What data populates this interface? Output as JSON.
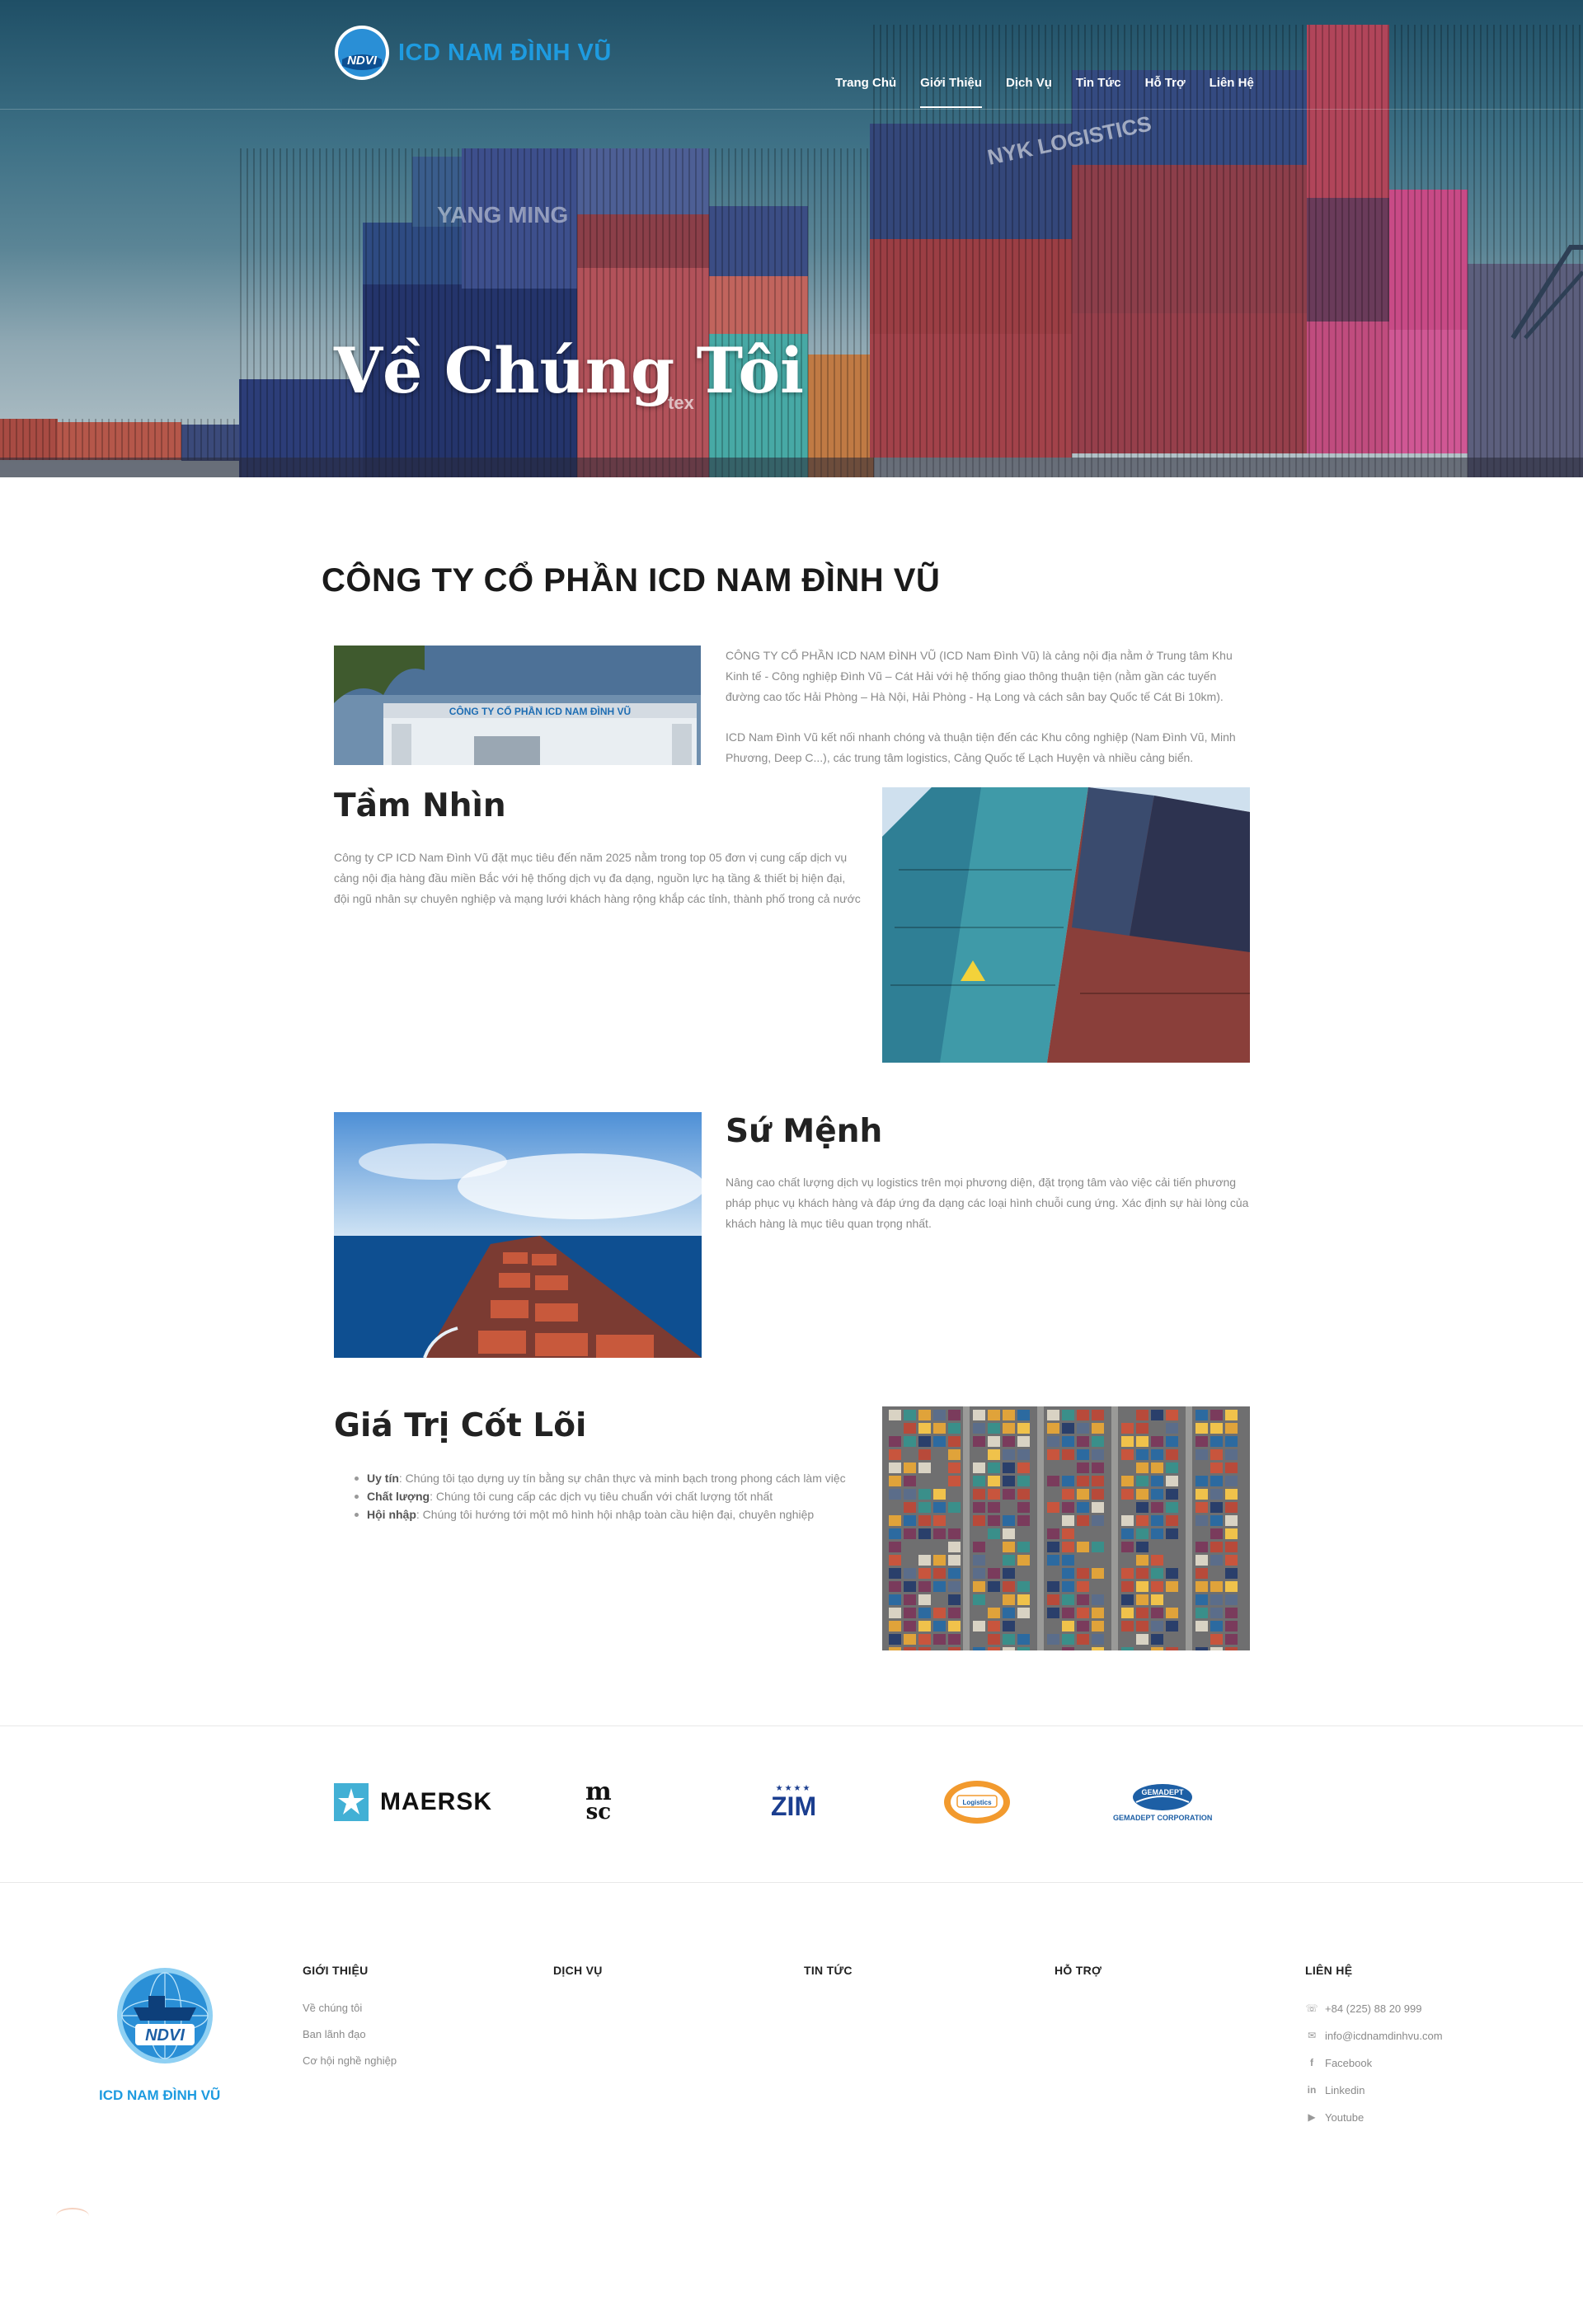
{
  "header": {
    "brand": "ICD NAM ĐÌNH VŨ",
    "logo_text": "NDVI",
    "nav": [
      {
        "label": "Trang Chủ",
        "active": false
      },
      {
        "label": "Giới Thiệu",
        "active": true
      },
      {
        "label": "Dịch Vụ",
        "active": false
      },
      {
        "label": "Tin Tức",
        "active": false
      },
      {
        "label": "Hỗ Trợ",
        "active": false
      },
      {
        "label": "Liên Hệ",
        "active": false
      }
    ]
  },
  "hero": {
    "title": "Về Chúng Tôi",
    "container_labels": [
      "NYK LOGISTICS",
      "YANG MING",
      "tex"
    ]
  },
  "intro": {
    "title": "CÔNG TY CỔ PHẦN ICD NAM ĐÌNH VŨ",
    "image_sign": "CÔNG TY CỔ PHẦN ICD NAM ĐÌNH VŨ",
    "paragraph1": "CÔNG TY CỔ PHẦN ICD NAM ĐÌNH VŨ (ICD Nam Đình Vũ) là cảng nội địa nằm ở Trung tâm Khu Kinh tế - Công nghiệp Đình Vũ – Cát Hải với hệ thống giao thông thuận tiện (nằm gần các tuyến đường cao tốc Hải Phòng – Hà Nội, Hải Phòng - Hạ Long và cách sân bay Quốc tế Cát Bi 10km).",
    "paragraph2": "ICD Nam Đình Vũ kết nối nhanh chóng và thuận tiện đến các Khu công nghiệp (Nam Đình Vũ, Minh Phương, Deep C...), các trung tâm logistics, Cảng Quốc tế Lạch Huyện và nhiều cảng biển."
  },
  "vision": {
    "title": "Tầm Nhìn",
    "text": "Công ty CP ICD Nam Đình Vũ đặt mục tiêu đến năm 2025 nằm trong top 05 đơn vị cung cấp dịch vụ cảng nội địa hàng đầu miền Bắc với hệ thống dịch vụ đa dạng, nguồn lực hạ tầng & thiết bị hiện đại, đội ngũ nhân sự chuyên nghiệp và mạng lưới khách hàng rộng khắp các tỉnh, thành phố trong cả nước"
  },
  "mission": {
    "title": "Sứ Mệnh",
    "text": "Nâng cao chất lượng dịch vụ logistics trên mọi phương diện, đặt trọng tâm vào việc cải tiến phương pháp phục vụ khách hàng và đáp ứng đa dạng các loại hình chuỗi cung ứng. Xác định sự hài lòng của khách hàng là mục tiêu quan trọng nhất."
  },
  "values": {
    "title": "Giá Trị Cốt Lõi",
    "items": [
      {
        "term": "Uy tín",
        "desc": ": Chúng tôi tạo dựng uy tín bằng sự chân thực và minh bạch trong phong cách làm việc"
      },
      {
        "term": "Chất lượng",
        "desc": ": Chúng tôi cung cấp các dịch vụ tiêu chuẩn với chất lượng tốt nhất"
      },
      {
        "term": "Hội nhập",
        "desc": ": Chúng tôi hướng tới một mô hình hội nhập toàn cầu hiện đại, chuyên nghiệp"
      }
    ]
  },
  "partners": {
    "maersk": "MAERSK",
    "msc_top": "m",
    "msc_bottom": "sc",
    "zim": "ZIM",
    "lamnfood": "Logistics",
    "gemadept_badge": "GEMADEPT",
    "gemadept_caption": "GEMADEPT CORPORATION"
  },
  "footer": {
    "brand": "ICD NAM ĐÌNH VŨ",
    "logo_text": "NDVI",
    "columns": [
      {
        "title": "GIỚI THIỆU",
        "links": [
          "Về chúng tôi",
          "Ban lãnh đạo",
          "Cơ hội nghề nghiệp"
        ]
      },
      {
        "title": "DỊCH VỤ",
        "links": []
      },
      {
        "title": "TIN TỨC",
        "links": []
      },
      {
        "title": "HỖ TRỢ",
        "links": []
      }
    ],
    "contact": {
      "title": "LIÊN HỆ",
      "phone": "+84 (225) 88 20 999",
      "email": "info@icdnamdinhvu.com",
      "facebook": "Facebook",
      "linkedin": "Linkedin",
      "youtube": "Youtube"
    }
  },
  "colors": {
    "brand_blue": "#1e9be0",
    "text_dark": "#222222",
    "text_muted": "#8a8a8a"
  }
}
